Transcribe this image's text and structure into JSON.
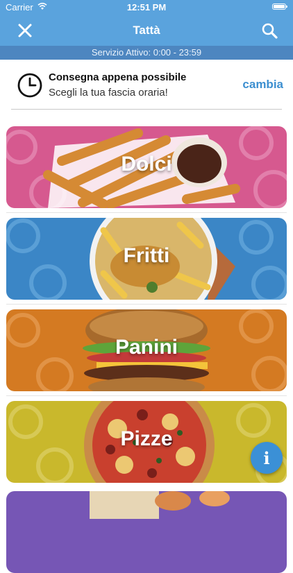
{
  "status": {
    "carrier": "Carrier",
    "time": "12:51 PM"
  },
  "nav": {
    "title": "Tattà",
    "close_icon": "close-icon",
    "search_icon": "search-icon"
  },
  "service": {
    "text": "Servizio Attivo: 0:00 - 23:59"
  },
  "delivery": {
    "title": "Consegna appena possibile",
    "subtitle": "Scegli la tua fascia oraria!",
    "change_label": "cambia",
    "icon": "clock-icon"
  },
  "categories": [
    {
      "label": "Dolci",
      "color": "#d6598f"
    },
    {
      "label": "Fritti",
      "color": "#3b86c6"
    },
    {
      "label": "Panini",
      "color": "#d47a22"
    },
    {
      "label": "Pizze",
      "color": "#c9b82c"
    },
    {
      "label": "",
      "color": "#7656b5"
    }
  ],
  "accent": "#5aa3dd",
  "info_button": {
    "label": "i",
    "icon": "info-icon"
  }
}
